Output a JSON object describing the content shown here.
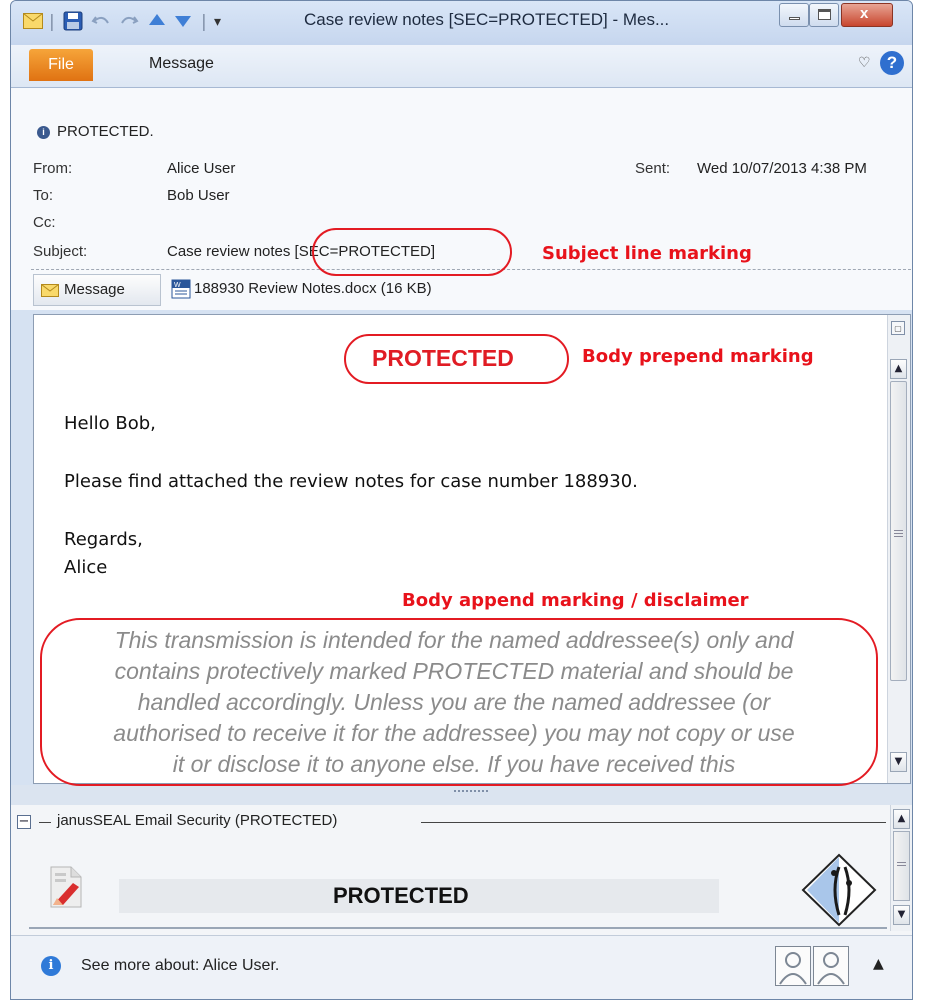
{
  "window": {
    "title": "Case review notes [SEC=PROTECTED] - Mes...",
    "quick_access_sep": "|",
    "customize_glyph": "▾"
  },
  "ribbon": {
    "file_tab": "File",
    "message_tab": "Message",
    "help_glyph": "?",
    "collapse_glyph": "♡"
  },
  "header": {
    "info_bar": "PROTECTED.",
    "from_label": "From:",
    "from_value": "Alice User",
    "sent_label": "Sent:",
    "sent_value": "Wed 10/07/2013 4:38 PM",
    "to_label": "To:",
    "to_value": "Bob User",
    "cc_label": "Cc:",
    "subject_label": "Subject:",
    "subject_value": "Case review notes [SEC=PROTECTED]"
  },
  "attachments": {
    "message_tab": "Message",
    "file_name": "188930 Review Notes.docx (16 KB)"
  },
  "body": {
    "marking": "PROTECTED",
    "greeting": "Hello Bob,",
    "line1": "Please find attached the review notes for case number 188930.",
    "regards": "Regards,",
    "signature": "Alice",
    "disclaimer_lines": [
      "This transmission is intended for the named addressee(s) only and",
      "contains protectively marked PROTECTED material and should be",
      "handled accordingly. Unless you are the named addressee (or",
      "authorised to receive it for the addressee) you may not copy or use",
      "it or disclose it to anyone else. If you have received this"
    ]
  },
  "annotations": {
    "subject": "Subject line marking",
    "prepend": "Body prepend marking",
    "append": "Body append marking / disclaimer"
  },
  "security_pane": {
    "title": "janusSEAL Email Security (PROTECTED)",
    "classification": "PROTECTED",
    "collapse_glyph": "−"
  },
  "people_pane": {
    "text": "See more about: Alice User."
  },
  "colors": {
    "annotation_red": "#e8121b",
    "file_tab_orange": "#e8851c",
    "ribbon_blue": "#dde7f4"
  }
}
